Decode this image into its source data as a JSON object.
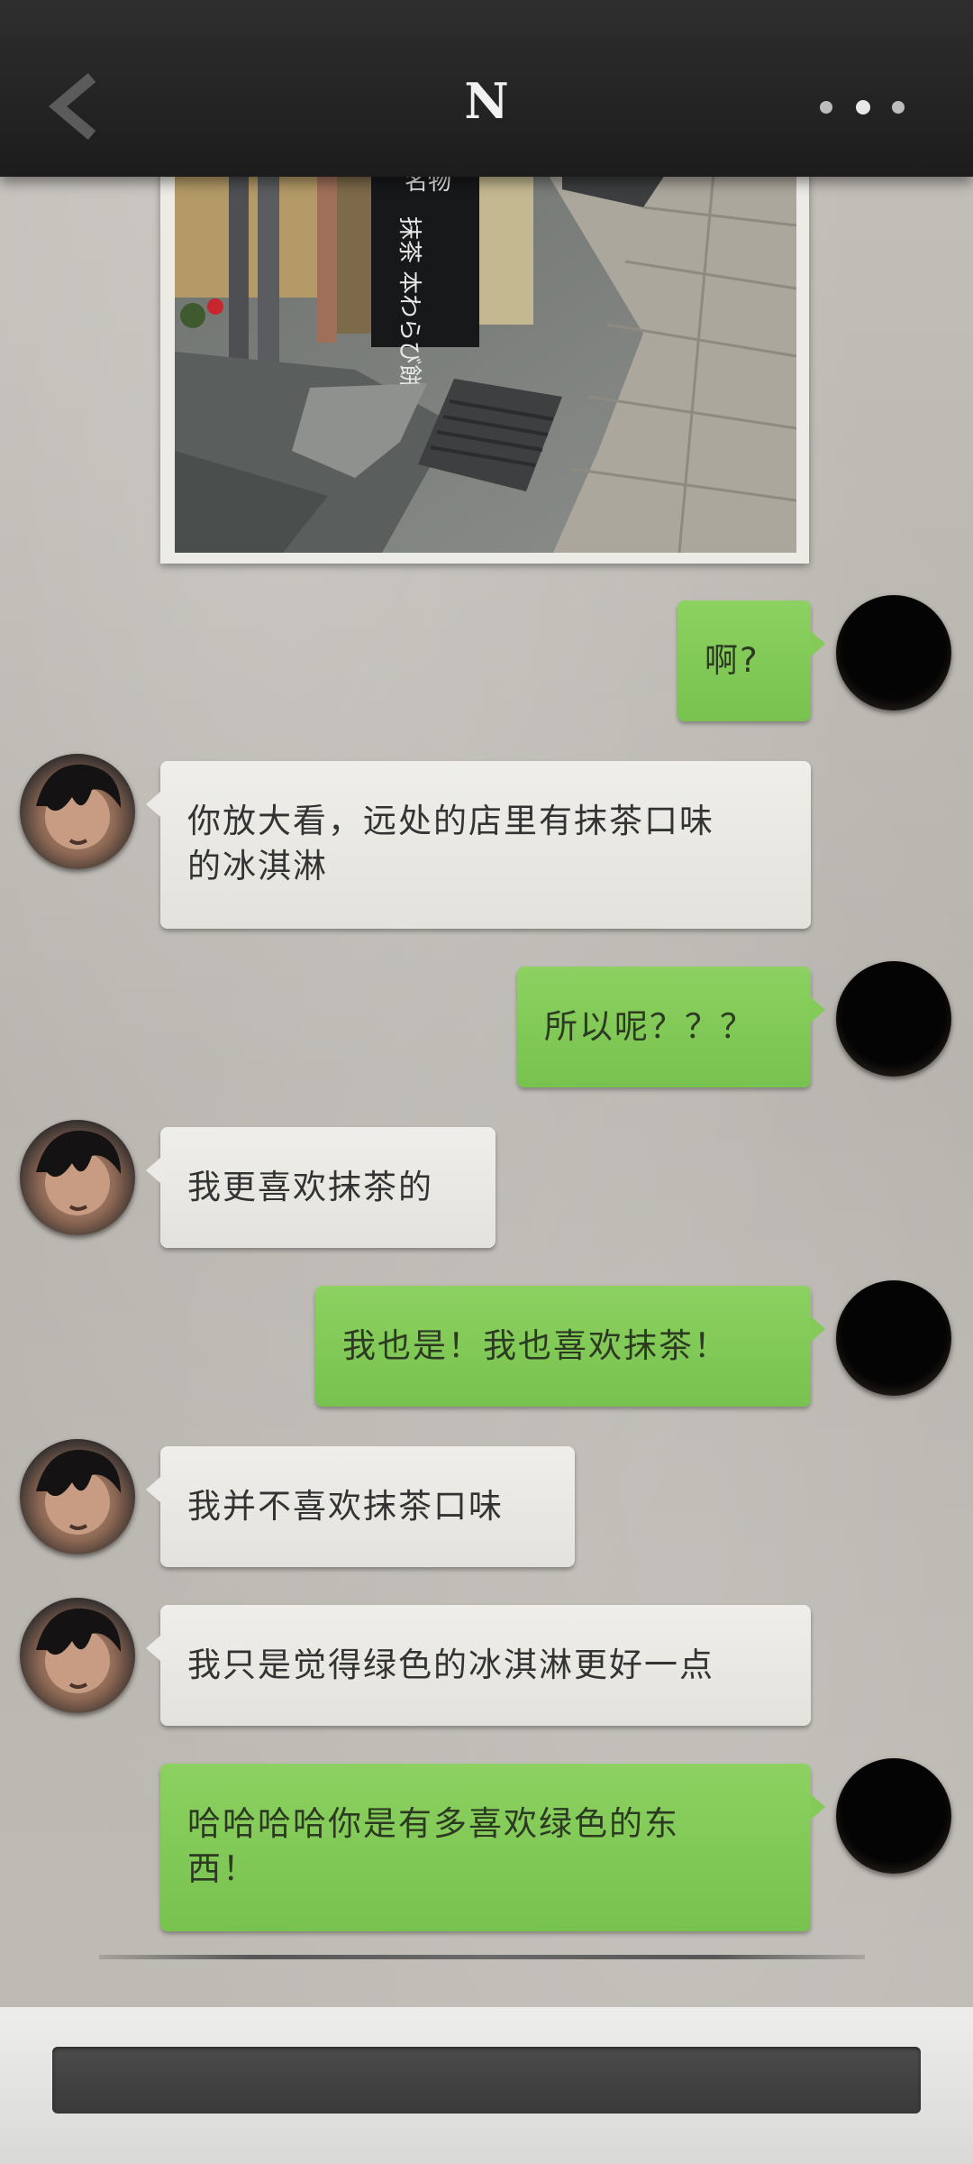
{
  "header": {
    "title": "N",
    "back_icon": "chevron-left-icon",
    "more_icon": "more-dots-icon"
  },
  "shared_photo": {
    "sign_lines": [
      "名物",
      "抹茶 本わらび餅"
    ]
  },
  "messages": [
    {
      "sender": "me",
      "text": "啊?"
    },
    {
      "sender": "N",
      "lines": [
        "你放大看，远处的店里有抹茶口味",
        "的冰淇淋"
      ]
    },
    {
      "sender": "me",
      "text": "所以呢？？？"
    },
    {
      "sender": "N",
      "text": "我更喜欢抹茶的"
    },
    {
      "sender": "me",
      "text": "我也是！我也喜欢抹茶！"
    },
    {
      "sender": "N",
      "text": "我并不喜欢抹茶口味"
    },
    {
      "sender": "N",
      "text": "我只是觉得绿色的冰淇淋更好一点"
    },
    {
      "sender": "me",
      "lines": [
        "哈哈哈哈你是有多喜欢绿色的东",
        "西！"
      ]
    }
  ],
  "colors": {
    "my_bubble": "#84ca59",
    "other_bubble": "#ebeae6",
    "topbar": "#262525",
    "background": "#bdb9b3"
  }
}
